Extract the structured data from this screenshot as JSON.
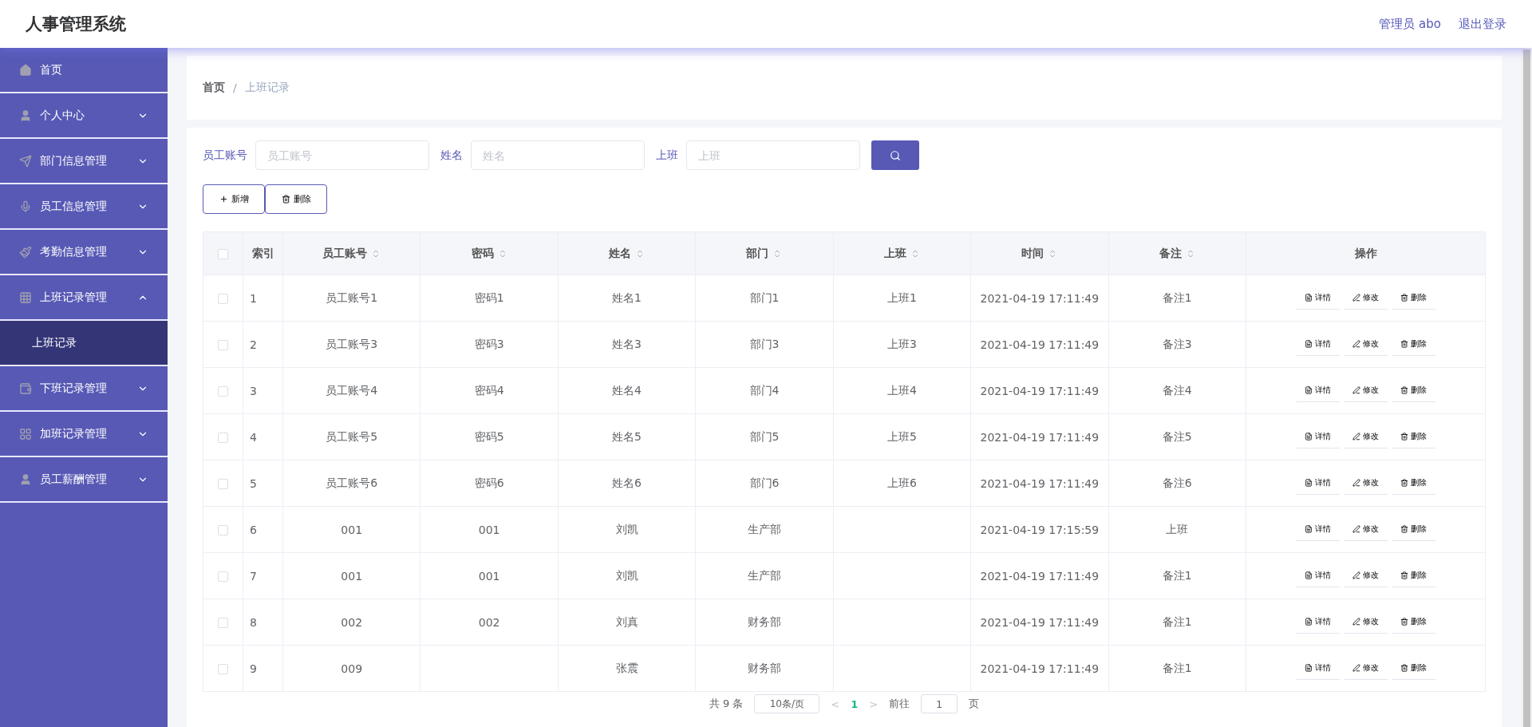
{
  "header": {
    "title": "人事管理系统",
    "user": "管理员 abo",
    "logout": "退出登录"
  },
  "sidebar": {
    "items": [
      {
        "label": "首页",
        "kind": "link"
      },
      {
        "label": "个人中心",
        "kind": "menu",
        "expanded": false
      },
      {
        "label": "部门信息管理",
        "kind": "menu",
        "expanded": false
      },
      {
        "label": "员工信息管理",
        "kind": "menu",
        "expanded": false
      },
      {
        "label": "考勤信息管理",
        "kind": "menu",
        "expanded": false
      },
      {
        "label": "上班记录管理",
        "kind": "menu",
        "expanded": true,
        "children": [
          {
            "label": "上班记录",
            "selected": true
          }
        ]
      },
      {
        "label": "下班记录管理",
        "kind": "menu",
        "expanded": false
      },
      {
        "label": "加班记录管理",
        "kind": "menu",
        "expanded": false
      },
      {
        "label": "员工薪酬管理",
        "kind": "menu",
        "expanded": false
      }
    ]
  },
  "breadcrumb": {
    "items": [
      "首页",
      "上班记录"
    ],
    "separator": "/"
  },
  "search": {
    "fields": [
      {
        "label": "员工账号",
        "placeholder": "员工账号"
      },
      {
        "label": "姓名",
        "placeholder": "姓名"
      },
      {
        "label": "上班",
        "placeholder": "上班"
      }
    ]
  },
  "actions": [
    {
      "label": "新增",
      "kind": "add"
    },
    {
      "label": "删除",
      "kind": "delete"
    }
  ],
  "table": {
    "all_checked": false,
    "columns": [
      {
        "label": "索引",
        "sortable": false
      },
      {
        "label": "员工账号",
        "sortable": true
      },
      {
        "label": "密码",
        "sortable": true
      },
      {
        "label": "姓名",
        "sortable": true
      },
      {
        "label": "部门",
        "sortable": true
      },
      {
        "label": "上班",
        "sortable": true
      },
      {
        "label": "时间",
        "sortable": true
      },
      {
        "label": "备注",
        "sortable": true
      },
      {
        "label": "操作",
        "sortable": false
      }
    ],
    "rows": [
      {
        "checked": false,
        "cells": [
          "1",
          "员工账号1",
          "密码1",
          "姓名1",
          "部门1",
          "上班1",
          "2021-04-19 17:11:49",
          "备注1"
        ],
        "actions": [
          "详情",
          "修改",
          "删除"
        ]
      },
      {
        "checked": false,
        "cells": [
          "2",
          "员工账号3",
          "密码3",
          "姓名3",
          "部门3",
          "上班3",
          "2021-04-19 17:11:49",
          "备注3"
        ],
        "actions": [
          "详情",
          "修改",
          "删除"
        ]
      },
      {
        "checked": false,
        "cells": [
          "3",
          "员工账号4",
          "密码4",
          "姓名4",
          "部门4",
          "上班4",
          "2021-04-19 17:11:49",
          "备注4"
        ],
        "actions": [
          "详情",
          "修改",
          "删除"
        ]
      },
      {
        "checked": false,
        "cells": [
          "4",
          "员工账号5",
          "密码5",
          "姓名5",
          "部门5",
          "上班5",
          "2021-04-19 17:11:49",
          "备注5"
        ],
        "actions": [
          "详情",
          "修改",
          "删除"
        ]
      },
      {
        "checked": false,
        "cells": [
          "5",
          "员工账号6",
          "密码6",
          "姓名6",
          "部门6",
          "上班6",
          "2021-04-19 17:11:49",
          "备注6"
        ],
        "actions": [
          "详情",
          "修改",
          "删除"
        ]
      },
      {
        "checked": false,
        "cells": [
          "6",
          "001",
          "001",
          "刘凯",
          "生产部",
          "",
          "2021-04-19 17:15:59",
          "上班"
        ],
        "actions": [
          "详情",
          "修改",
          "删除"
        ]
      },
      {
        "checked": false,
        "cells": [
          "7",
          "001",
          "001",
          "刘凯",
          "生产部",
          "",
          "2021-04-19 17:11:49",
          "备注1"
        ],
        "actions": [
          "详情",
          "修改",
          "删除"
        ]
      },
      {
        "checked": false,
        "cells": [
          "8",
          "002",
          "002",
          "刘真",
          "财务部",
          "",
          "2021-04-19 17:11:49",
          "备注1"
        ],
        "actions": [
          "详情",
          "修改",
          "删除"
        ]
      },
      {
        "checked": false,
        "cells": [
          "9",
          "009",
          "",
          "张震",
          "财务部",
          "",
          "2021-04-19 17:11:49",
          "备注1"
        ],
        "actions": [
          "详情",
          "修改",
          "删除"
        ]
      }
    ]
  },
  "pagination": {
    "total": "共 9 条",
    "page_size": "10条/页",
    "prev": "<",
    "pages": [
      {
        "label": "1",
        "selected": true
      }
    ],
    "next": ">",
    "goto_label": "前往",
    "goto_value": "1",
    "goto_suffix": "页"
  }
}
